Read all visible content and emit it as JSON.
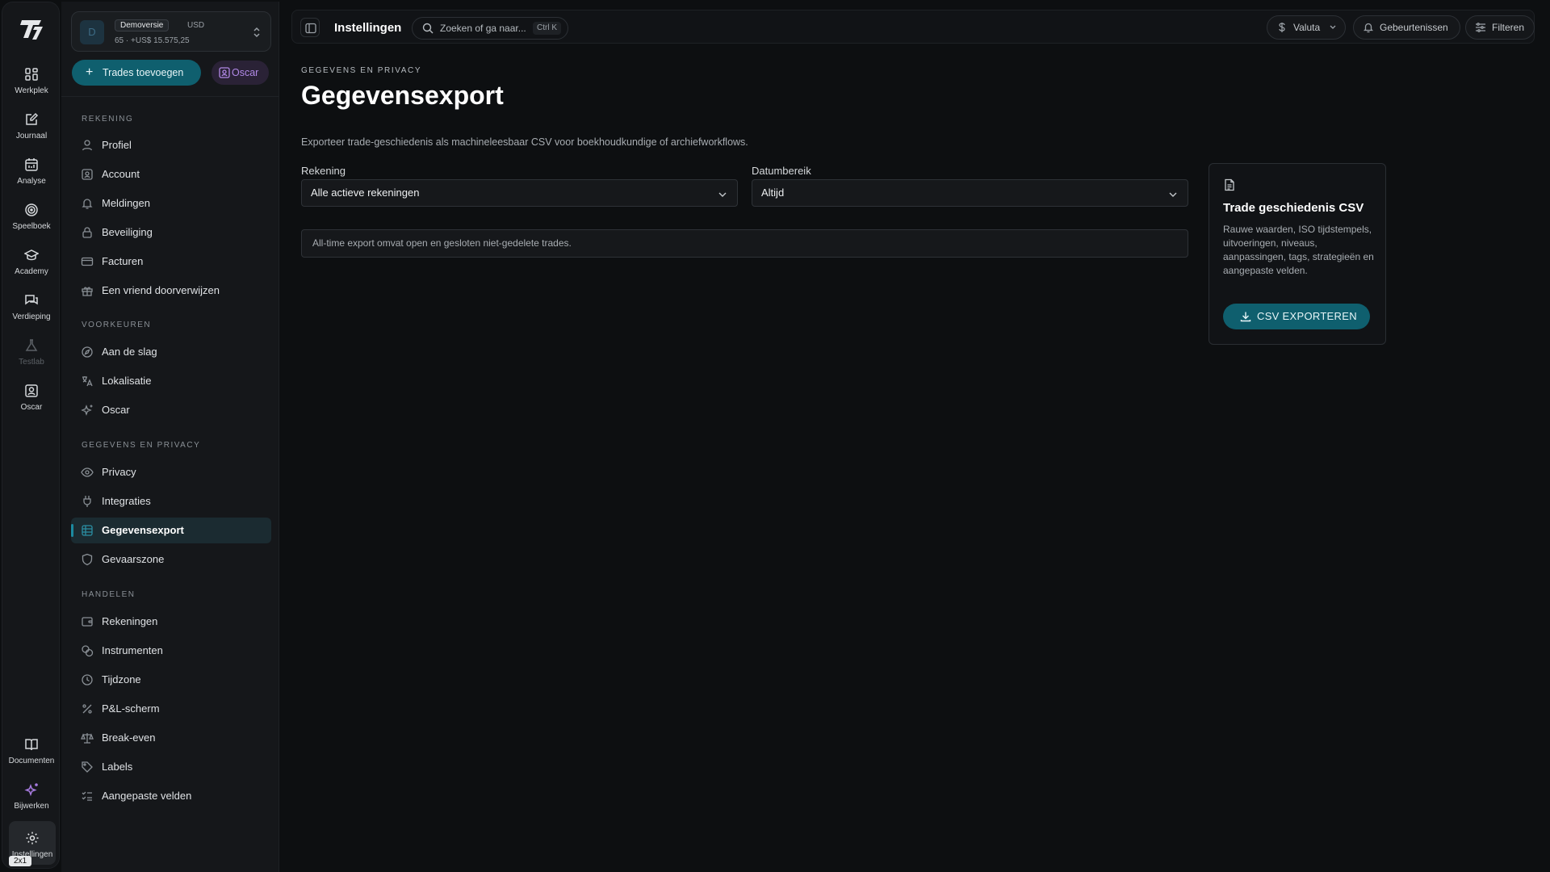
{
  "rail": {
    "items": [
      {
        "label": "Werkplek",
        "icon": "grid-icon"
      },
      {
        "label": "Journaal",
        "icon": "notebook-pen-icon"
      },
      {
        "label": "Analyse",
        "icon": "calendar-chart-icon"
      },
      {
        "label": "Speelboek",
        "icon": "target-icon"
      },
      {
        "label": "Academy",
        "icon": "graduation-cap-icon"
      },
      {
        "label": "Verdieping",
        "icon": "chat-bubbles-icon"
      },
      {
        "label": "Testlab",
        "icon": "flask-icon"
      },
      {
        "label": "Oscar",
        "icon": "contact-icon"
      }
    ],
    "bottom": [
      {
        "label": "Documenten",
        "icon": "book-open-icon"
      },
      {
        "label": "Bijwerken",
        "icon": "sparkles-icon"
      },
      {
        "label": "Instellingen",
        "icon": "gear-icon"
      }
    ],
    "badge": "2x1"
  },
  "account": {
    "avatar": "D",
    "mode": "Demoversie",
    "currency": "USD",
    "balance": "65 · +US$ 15.575,25"
  },
  "actions": {
    "add_trades": "Trades toevoegen",
    "oscar": "Oscar"
  },
  "sections": [
    {
      "title": "REKENING",
      "items": [
        "Profiel",
        "Account",
        "Meldingen",
        "Beveiliging",
        "Facturen",
        "Een vriend doorverwijzen"
      ]
    },
    {
      "title": "VOORKEUREN",
      "items": [
        "Aan de slag",
        "Lokalisatie",
        "Oscar"
      ]
    },
    {
      "title": "GEGEVENS EN PRIVACY",
      "items": [
        "Privacy",
        "Integraties",
        "Gegevensexport",
        "Gevaarszone"
      ]
    },
    {
      "title": "HANDELEN",
      "items": [
        "Rekeningen",
        "Instrumenten",
        "Tijdzone",
        "P&L-scherm",
        "Break-even",
        "Labels",
        "Aangepaste velden"
      ]
    }
  ],
  "topbar": {
    "title": "Instellingen",
    "search_placeholder": "Zoeken of ga naar...",
    "search_shortcut": "Ctrl K",
    "currency_btn": "Valuta",
    "events_btn": "Gebeurtenissen",
    "filter_btn": "Filteren"
  },
  "page": {
    "breadcrumb": "GEGEVENS EN PRIVACY",
    "title": "Gegevensexport",
    "description": "Exporteer trade-geschiedenis als machineleesbaar CSV voor boekhoudkundige of archiefworkflows.",
    "account_label": "Rekening",
    "account_value": "Alle actieve rekeningen",
    "range_label": "Datumbereik",
    "range_value": "Altijd",
    "note": "All-time export omvat open en gesloten niet-gedelete trades."
  },
  "card": {
    "title": "Trade geschiedenis CSV",
    "description": "Rauwe waarden, ISO tijdstempels, uitvoeringen, niveaus, aanpassingen, tags, strategieën en aangepaste velden.",
    "button": "CSV EXPORTEREN"
  },
  "colors": {
    "accent": "#0f5f6e",
    "oscar": "#b189e6",
    "background": "#0d0f11"
  }
}
